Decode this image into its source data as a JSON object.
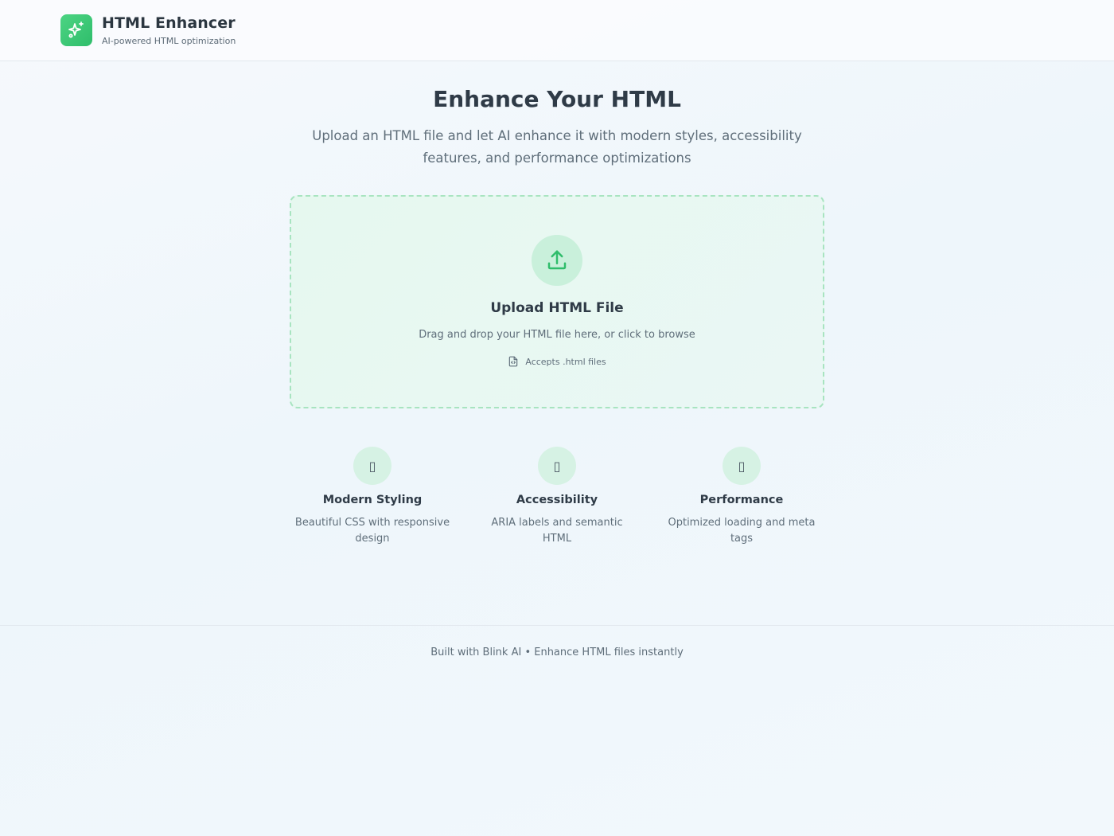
{
  "header": {
    "title": "HTML Enhancer",
    "subtitle": "AI-powered HTML optimization",
    "logo_icon": "sparkles-icon"
  },
  "hero": {
    "title": "Enhance Your HTML",
    "subtitle": "Upload an HTML file and let AI enhance it with modern styles, accessibility features, and performance optimizations"
  },
  "upload": {
    "icon": "upload-icon",
    "title": "Upload HTML File",
    "description": "Drag and drop your HTML file here, or click to browse",
    "accepts_icon": "file-code-icon",
    "accepts": "Accepts .html files"
  },
  "features": [
    {
      "icon": "palette-icon",
      "icon_glyph": "▯",
      "title": "Modern Styling",
      "description": "Beautiful CSS with responsive design"
    },
    {
      "icon": "accessibility-icon",
      "icon_glyph": "▯",
      "title": "Accessibility",
      "description": "ARIA labels and semantic HTML"
    },
    {
      "icon": "zap-icon",
      "icon_glyph": "▯",
      "title": "Performance",
      "description": "Optimized loading and meta tags"
    }
  ],
  "footer": {
    "text": "Built with Blink AI • Enhance HTML files instantly"
  },
  "colors": {
    "accent": "#2fbd6b",
    "accent_light": "#c9f0db",
    "dashed_border": "#a8e4c0",
    "text_primary": "#2f3b47",
    "text_secondary": "#5f6e7a"
  }
}
